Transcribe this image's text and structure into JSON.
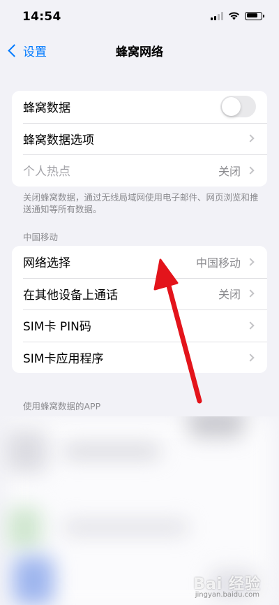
{
  "status_bar": {
    "time": "14:54"
  },
  "nav": {
    "back_label": "设置",
    "title": "蜂窝网络"
  },
  "group1": {
    "rows": [
      {
        "label": "蜂窝数据",
        "toggle": false
      },
      {
        "label": "蜂窝数据选项"
      },
      {
        "label": "个人热点",
        "value": "关闭",
        "disabled": true
      }
    ]
  },
  "group1_footer": "关闭蜂窝数据，通过无线局域网使用电子邮件、网页浏览和推送通知等所有数据。",
  "carrier_header": "中国移动",
  "group2": {
    "rows": [
      {
        "label": "网络选择",
        "value": "中国移动"
      },
      {
        "label": "在其他设备上通话",
        "value": "关闭"
      },
      {
        "label": "SIM卡 PIN码"
      },
      {
        "label": "SIM卡应用程序"
      }
    ]
  },
  "apps_header": "使用蜂窝数据的APP",
  "watermark": {
    "main": "Bai 经验",
    "sub": "jingyan.baidu.com"
  },
  "colors": {
    "accent": "#007aff",
    "arrow": "#e3141b",
    "background": "#f2f2f7"
  }
}
